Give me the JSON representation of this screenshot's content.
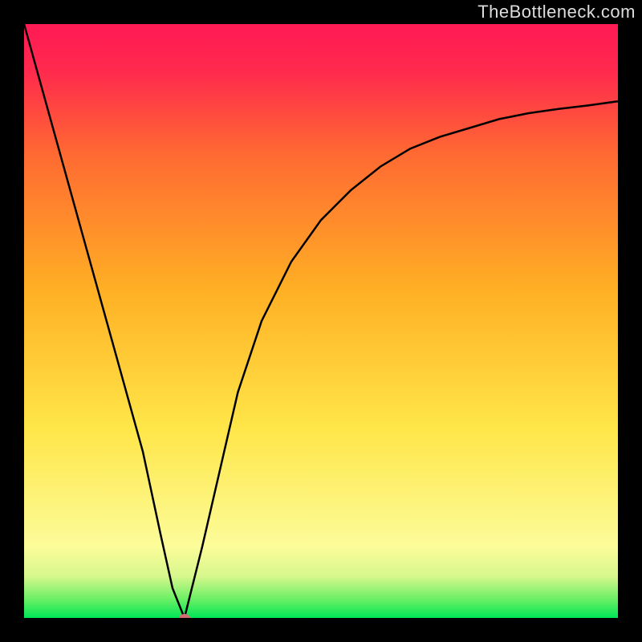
{
  "watermark": "TheBottleneck.com",
  "chart_data": {
    "type": "line",
    "title": "",
    "xlabel": "",
    "ylabel": "",
    "xlim": [
      0,
      100
    ],
    "ylim": [
      0,
      100
    ],
    "grid": false,
    "series": [
      {
        "name": "bottleneck-curve",
        "color": "#000000",
        "x": [
          0,
          5,
          10,
          15,
          20,
          23,
          25,
          27,
          30,
          33,
          36,
          40,
          45,
          50,
          55,
          60,
          65,
          70,
          75,
          80,
          85,
          90,
          95,
          100
        ],
        "values": [
          100,
          82,
          64,
          46,
          28,
          14,
          5,
          0,
          12,
          25,
          38,
          50,
          60,
          67,
          72,
          76,
          79,
          81,
          82.5,
          84,
          85,
          85.7,
          86.3,
          87
        ]
      }
    ],
    "markers": [
      {
        "name": "min-point",
        "x": 27,
        "y": 0,
        "color": "#d26d73"
      }
    ],
    "background_gradient": {
      "direction": "bottom-to-top",
      "stops": [
        {
          "pos": 0,
          "color": "#00e756"
        },
        {
          "pos": 12,
          "color": "#fcfc9a"
        },
        {
          "pos": 32,
          "color": "#ffe648"
        },
        {
          "pos": 55,
          "color": "#ffb024"
        },
        {
          "pos": 78,
          "color": "#ff6a32"
        },
        {
          "pos": 100,
          "color": "#ff1a55"
        }
      ]
    }
  },
  "marker_color": "#d26d73",
  "curve_color": "#000000"
}
